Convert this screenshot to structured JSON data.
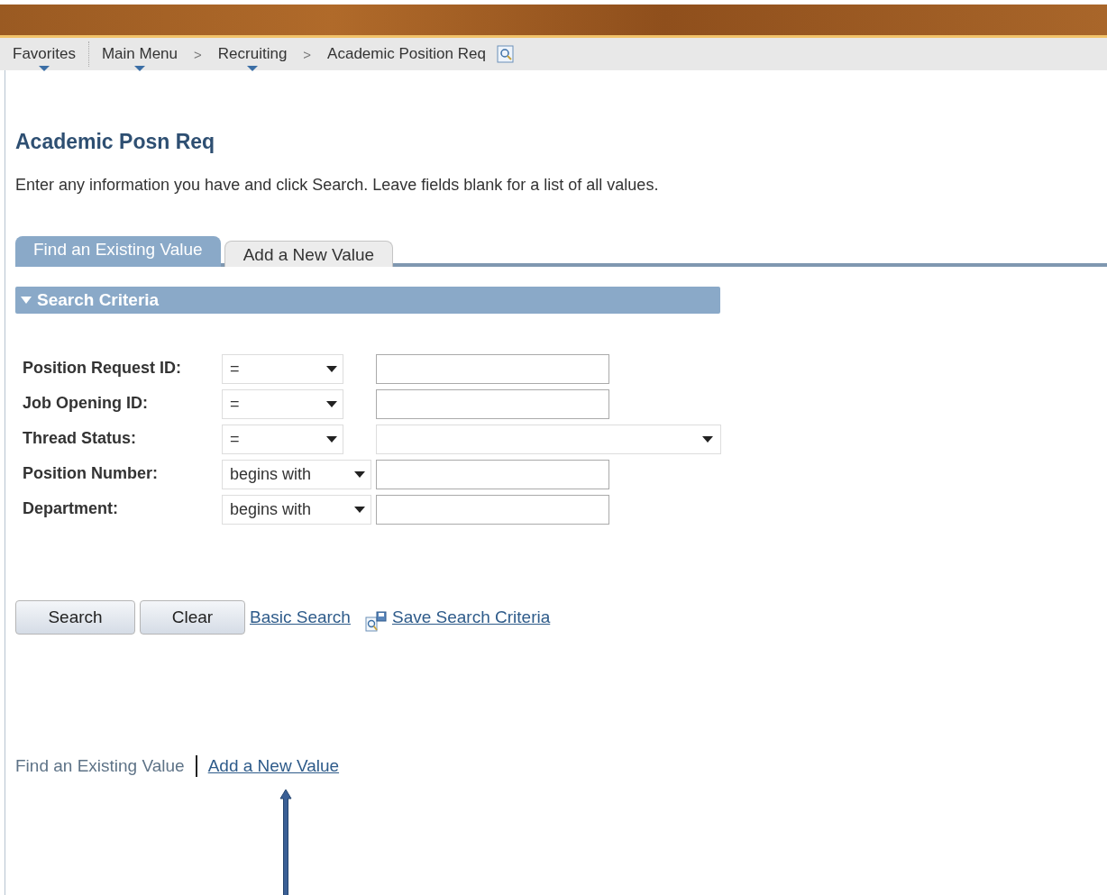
{
  "breadcrumb": [
    {
      "kind": "menu",
      "label": "Favorites"
    },
    {
      "kind": "divider"
    },
    {
      "kind": "menu",
      "label": "Main Menu"
    },
    {
      "kind": "separator",
      "label": ">"
    },
    {
      "kind": "menu",
      "label": "Recruiting"
    },
    {
      "kind": "separator",
      "label": ">"
    },
    {
      "kind": "page",
      "label": "Academic Position Req"
    }
  ],
  "page_title": "Academic Posn Req",
  "instructions": "Enter any information you have and click Search. Leave fields blank for a list of all values.",
  "tabs": [
    {
      "label": "Find an Existing Value",
      "selected": true
    },
    {
      "label": "Add a New Value",
      "selected": false
    }
  ],
  "section": {
    "title": "Search Criteria",
    "expanded": true
  },
  "fields": [
    {
      "label": "Position Request ID:",
      "operator": "=",
      "kind": "text"
    },
    {
      "label": "Job Opening ID:",
      "operator": "=",
      "kind": "text"
    },
    {
      "label": "Thread Status:",
      "operator": "=",
      "kind": "select"
    },
    {
      "label": "Position Number:",
      "operator": "begins with",
      "kind": "text"
    },
    {
      "label": "Department:",
      "operator": "begins with",
      "kind": "text"
    }
  ],
  "buttons": [
    "Search",
    "Clear"
  ],
  "links": [
    {
      "label": "Basic Search",
      "icon": false
    },
    {
      "label": "Save Search Criteria",
      "icon": true
    }
  ],
  "footer_links": [
    {
      "label": "Find an Existing Value",
      "selected": true
    },
    {
      "label": "Add a New Value",
      "selected": false
    }
  ]
}
